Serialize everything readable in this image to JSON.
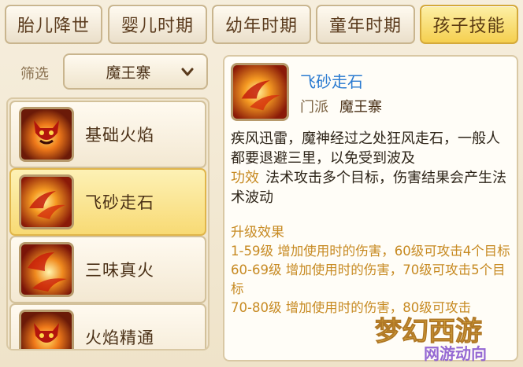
{
  "tabs": [
    {
      "label": "胎儿降世",
      "active": false
    },
    {
      "label": "婴儿时期",
      "active": false
    },
    {
      "label": "幼年时期",
      "active": false
    },
    {
      "label": "童年时期",
      "active": false
    },
    {
      "label": "孩子技能",
      "active": true
    }
  ],
  "filter": {
    "label": "筛选",
    "value": "魔王寨"
  },
  "skills": [
    {
      "name": "基础火焰",
      "icon": "demon-flame-icon",
      "selected": false
    },
    {
      "name": "飞砂走石",
      "icon": "flying-rock-icon",
      "selected": true
    },
    {
      "name": "三味真火",
      "icon": "true-fire-icon",
      "selected": false
    },
    {
      "name": "火焰精通",
      "icon": "demon-flame-icon",
      "selected": false
    }
  ],
  "detail": {
    "name": "飞砂走石",
    "sect_key": "门派",
    "sect_value": "魔王寨",
    "description": "疾风迅雷，魔神经过之处狂风走石，一般人都要退避三里，以免受到波及",
    "effect_key": "功效",
    "effect_value": "法术攻击多个目标，伤害结果会产生法术波动",
    "upgrade_title": "升级效果",
    "upgrades": [
      "1-59级  增加使用时的伤害，60级可攻击4个目标",
      "60-69级  增加使用时的伤害，70级可攻击5个目标",
      "70-80级  增加使用时的伤害，80级可攻击"
    ]
  },
  "watermark": {
    "text": "梦幻西游 网游动向"
  },
  "colors": {
    "accent": "#f5cf4f",
    "link": "#2a7ad0",
    "highlight": "#c78a22"
  }
}
